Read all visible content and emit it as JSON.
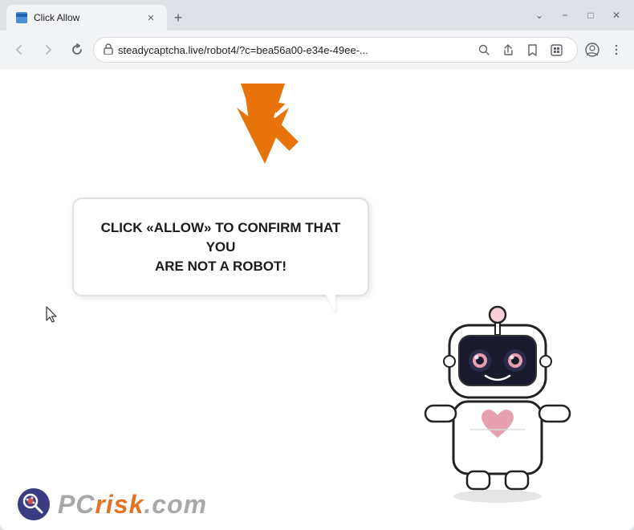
{
  "window": {
    "title": "Click Allow",
    "controls": {
      "minimize": "−",
      "maximize": "□",
      "close": "✕",
      "chevron_down": "⌄"
    }
  },
  "tab": {
    "title": "Click Allow",
    "close_label": "✕"
  },
  "new_tab_label": "+",
  "toolbar": {
    "back_arrow": "←",
    "forward_arrow": "→",
    "close_x": "✕",
    "url": "steadycaptcha.live/robot4/?c=bea56a00-e34e-49ee-...",
    "search_icon": "🔍",
    "share_icon": "⎙",
    "bookmark_icon": "☆",
    "extensions_icon": "□",
    "profile_icon": "👤",
    "menu_icon": "⋮"
  },
  "page": {
    "bubble_text_line1": "CLICK «ALLOW» TO CONFIRM THAT YOU",
    "bubble_text_line2": "ARE NOT A ROBOT!",
    "bubble_full_text": "CLICK «ALLOW» TO CONFIRM THAT YOU ARE NOT A ROBOT!"
  },
  "watermark": {
    "text_gray": "PC",
    "text_orange": "risk",
    "suffix": ".com"
  },
  "colors": {
    "arrow_orange": "#E8730A",
    "tab_bg": "#f1f3f4",
    "chrome_frame": "#dee1e6",
    "bubble_border": "#e0e0e0",
    "text_dark": "#1a1a1a",
    "watermark_gray": "#9a9a9a",
    "watermark_orange": "#e05a00"
  }
}
